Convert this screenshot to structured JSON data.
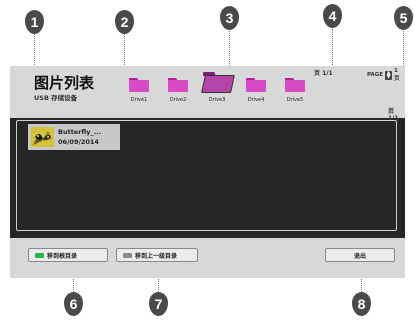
{
  "header": {
    "title": "图片列表",
    "device": "USB 存储设备"
  },
  "drives": [
    {
      "label": "Drive1",
      "selected": false
    },
    {
      "label": "Drive2",
      "selected": false
    },
    {
      "label": "Drive3",
      "selected": true
    },
    {
      "label": "Drive4",
      "selected": false
    },
    {
      "label": "Drive5",
      "selected": false
    }
  ],
  "paging": {
    "indicator": "页 1/1",
    "nav_label": "PAGE",
    "nav_suffix": "1 页",
    "total": "页 1/1"
  },
  "files": [
    {
      "name": "Butterfly_...",
      "date": "06/09/2014"
    }
  ],
  "footer": {
    "root_label": "移到根目录",
    "up_label": "移到上一级目录",
    "exit_label": "退出"
  },
  "callouts": [
    "1",
    "2",
    "3",
    "4",
    "5",
    "6",
    "7",
    "8"
  ],
  "colors": {
    "folder": "#d84ac6",
    "key_green": "#2db34a",
    "key_gray": "#8c8c8c"
  }
}
